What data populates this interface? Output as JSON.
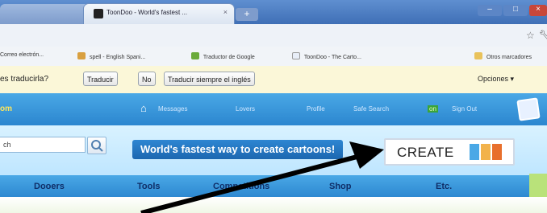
{
  "browser": {
    "active_tab_title": "ToonDoo - World's fastest ...",
    "tab_close_glyph": "×",
    "new_tab_glyph": "+",
    "window_buttons": {
      "minimize": "–",
      "maximize": "□",
      "close": "×"
    }
  },
  "bookmarks": [
    {
      "label": "Correo electrón...",
      "icon_color": "#dfe6f0"
    },
    {
      "label": "spell - English Spani...",
      "icon_color": "#d9a040"
    },
    {
      "label": "Traductor de Google",
      "icon_color": "#6aaa3a"
    },
    {
      "label": "ToonDoo - The Carto...",
      "icon_color": "#e8eef8"
    },
    {
      "label": "Otros marcadores",
      "icon_color": "#e9c25b"
    }
  ],
  "translate_bar": {
    "question": "es traducirla?",
    "translate_button": "Traducir",
    "no_button": "No",
    "always_button": "Traducir siempre el inglés",
    "options_label": "Opciones ▾"
  },
  "site": {
    "brand_fragment": "om",
    "top_links": [
      "Messages",
      "Lovers",
      "Profile",
      "Safe Search",
      "on",
      "Sign Out"
    ],
    "search": {
      "value": "ch"
    },
    "tagline": "World's fastest way to create cartoons!",
    "create_label": "CREATE",
    "create_colors": [
      "#4aa8e6",
      "#f2b24b",
      "#e86f2c"
    ],
    "nav": [
      "Dooers",
      "Tools",
      "Competitions",
      "Shop",
      "Etc."
    ],
    "icons": {
      "home": "home-icon",
      "edit": "edit-icon"
    }
  }
}
